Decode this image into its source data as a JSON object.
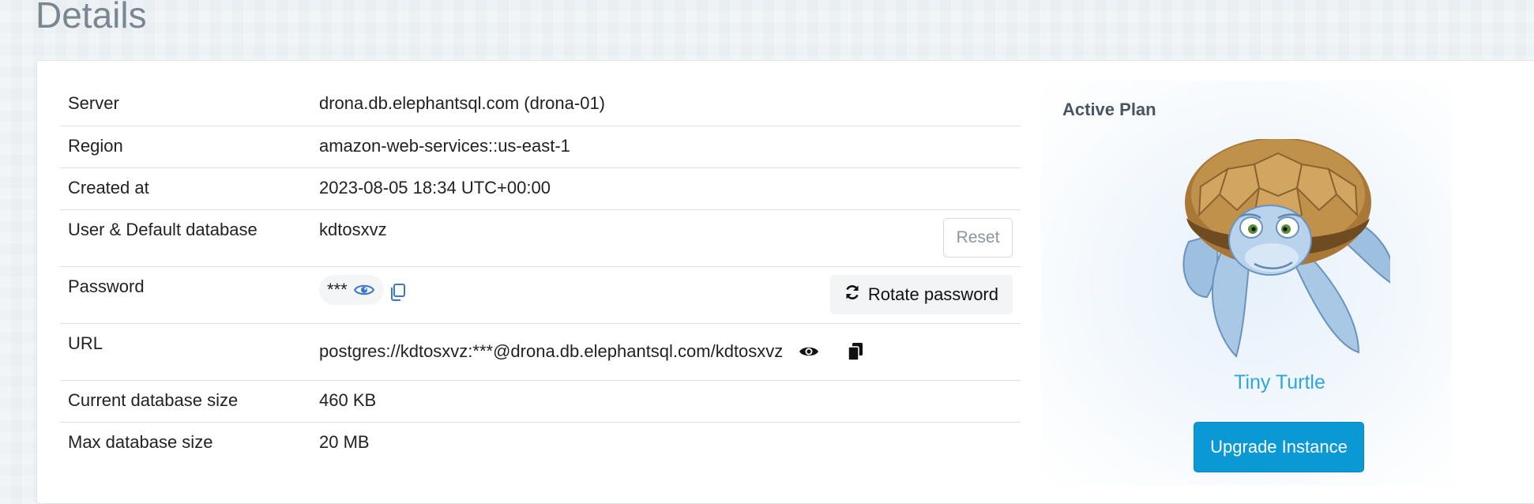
{
  "page": {
    "title": "Details"
  },
  "details": {
    "server": {
      "label": "Server",
      "value": "drona.db.elephantsql.com (drona-01)"
    },
    "region": {
      "label": "Region",
      "value": "amazon-web-services::us-east-1"
    },
    "created": {
      "label": "Created at",
      "value": "2023-08-05 18:34 UTC+00:00"
    },
    "user": {
      "label": "User & Default database",
      "value": "kdtosxvz",
      "reset_label": "Reset"
    },
    "password": {
      "label": "Password",
      "value": "***",
      "rotate_label": "Rotate password",
      "icons": [
        "eye-icon",
        "copy-icon",
        "refresh-icon"
      ]
    },
    "url": {
      "label": "URL",
      "value": "postgres://kdtosxvz:***@drona.db.elephantsql.com/kdtosxvz",
      "icons": [
        "eye-icon",
        "copy-icon"
      ]
    },
    "current_size": {
      "label": "Current database size",
      "value": "460 KB"
    },
    "max_size": {
      "label": "Max database size",
      "value": "20 MB"
    }
  },
  "plan": {
    "heading": "Active Plan",
    "name": "Tiny Turtle",
    "upgrade_label": "Upgrade Instance",
    "accent_color": "#2fa6db",
    "button_color": "#0b99d6"
  }
}
